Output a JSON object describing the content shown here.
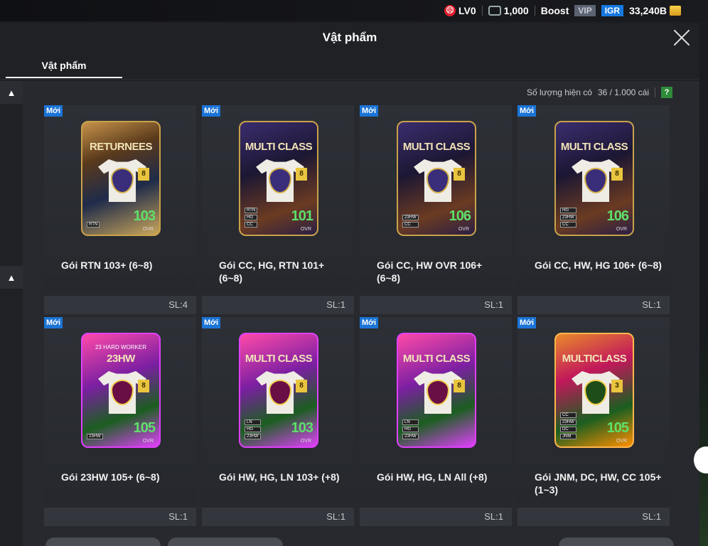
{
  "statusbar": {
    "level": "LV0",
    "coins": "1,000",
    "boost": "Boost",
    "vip": "VIP",
    "igr": "IGR",
    "bp": "33,240B"
  },
  "modal": {
    "title": "Vật phẩm",
    "tab": "Vật phẩm",
    "count_label": "Số lượng hiện có",
    "count_value": "36 / 1.000 cái",
    "help": "?"
  },
  "cards": [
    {
      "badge": "Mới",
      "pack_title": "RETURNEES",
      "pack_sub": "",
      "grade": "8",
      "ovr": "103",
      "ovr_label": "OVR",
      "name": "Gói RTN 103+ (6~8)",
      "qty": "SL:4"
    },
    {
      "badge": "Mới",
      "pack_title": "MULTI CLASS",
      "pack_sub": "",
      "grade": "8",
      "ovr": "101",
      "ovr_label": "OVR",
      "name": "Gói CC, HG, RTN 101+ (6~8)",
      "qty": "SL:1"
    },
    {
      "badge": "Mới",
      "pack_title": "MULTI CLASS",
      "pack_sub": "",
      "grade": "8",
      "ovr": "106",
      "ovr_label": "OVR",
      "name": "Gói CC, HW OVR 106+ (6~8)",
      "qty": "SL:1"
    },
    {
      "badge": "Mới",
      "pack_title": "MULTI CLASS",
      "pack_sub": "",
      "grade": "8",
      "ovr": "106",
      "ovr_label": "OVR",
      "name": "Gói CC, HW, HG 106+ (6~8)",
      "qty": "SL:1"
    },
    {
      "badge": "Mới",
      "pack_title": "23HW",
      "pack_sub": "23 HARD WORKER",
      "grade": "8",
      "ovr": "105",
      "ovr_label": "OVR",
      "name": "Gói 23HW 105+ (6~8)",
      "qty": "SL:1"
    },
    {
      "badge": "Mới",
      "pack_title": "MULTI CLASS",
      "pack_sub": "",
      "grade": "8",
      "ovr": "103",
      "ovr_label": "OVR",
      "name": "Gói HW, HG, LN 103+ (+8)",
      "qty": "SL:1"
    },
    {
      "badge": "Mới",
      "pack_title": "MULTI CLASS",
      "pack_sub": "",
      "grade": "8",
      "ovr": "",
      "ovr_label": "",
      "name": "Gói HW, HG, LN All (+8)",
      "qty": "SL:1"
    },
    {
      "badge": "Mới",
      "pack_title": "MULTICLASS",
      "pack_sub": "",
      "grade": "3",
      "ovr": "105",
      "ovr_label": "OVR",
      "name": "Gói JNM, DC, HW, CC 105+ (1~3)",
      "qty": "SL:1"
    }
  ]
}
